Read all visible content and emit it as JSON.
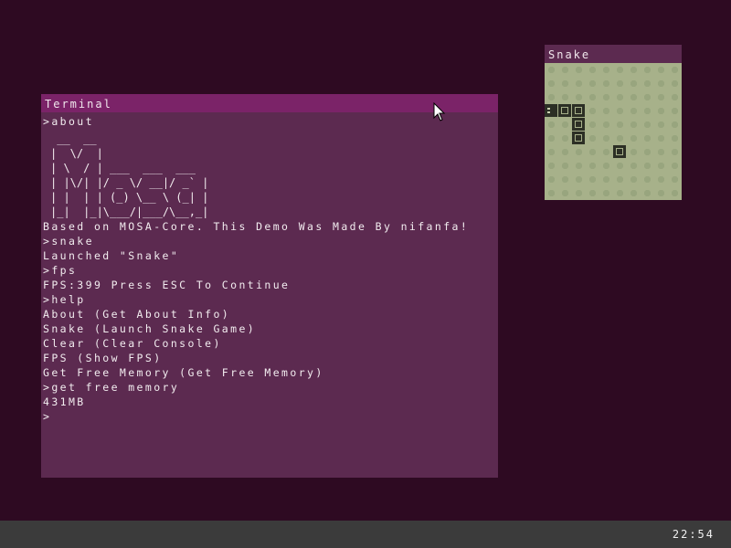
{
  "desktop": {
    "background_color": "#2e0a22"
  },
  "terminal": {
    "title": "Terminal",
    "titlebar_color": "#7b2368",
    "background_color": "#5c2a50",
    "lines_before_logo": [
      ">about"
    ],
    "ascii_logo": " __  __\n|  \\/  |\n| \\  / | ___  ___  ___\n| |\\/| |/ _ \\/ __|/ _` |\n| |  | | (_) \\__ \\ (_| |\n|_|  |_|\\___/|___/\\__,_|",
    "lines_after_logo": [
      "Based on MOSA-Core. This Demo Was Made By nifanfa!",
      ">snake",
      "Launched \"Snake\"",
      ">fps",
      "FPS:399 Press ESC To Continue",
      ">help",
      "About (Get About Info)",
      "Snake (Launch Snake Game)",
      "Clear (Clear Console)",
      "FPS (Show FPS)",
      "Get Free Memory (Get Free Memory)",
      ">get free memory",
      "431MB",
      ">"
    ]
  },
  "snake_window": {
    "title": "Snake",
    "board_color": "#a7b18a",
    "snake_color": "#2c2f25",
    "grid": {
      "columns": 10,
      "rows": 10
    },
    "snake_head": {
      "col": 0,
      "row": 3,
      "direction": "left"
    },
    "snake_body": [
      {
        "col": 1,
        "row": 3
      },
      {
        "col": 2,
        "row": 3
      },
      {
        "col": 2,
        "row": 4
      },
      {
        "col": 2,
        "row": 5
      }
    ],
    "food": {
      "col": 5,
      "row": 6
    }
  },
  "taskbar": {
    "clock": "22:54",
    "background_color": "#3b3b3b"
  }
}
